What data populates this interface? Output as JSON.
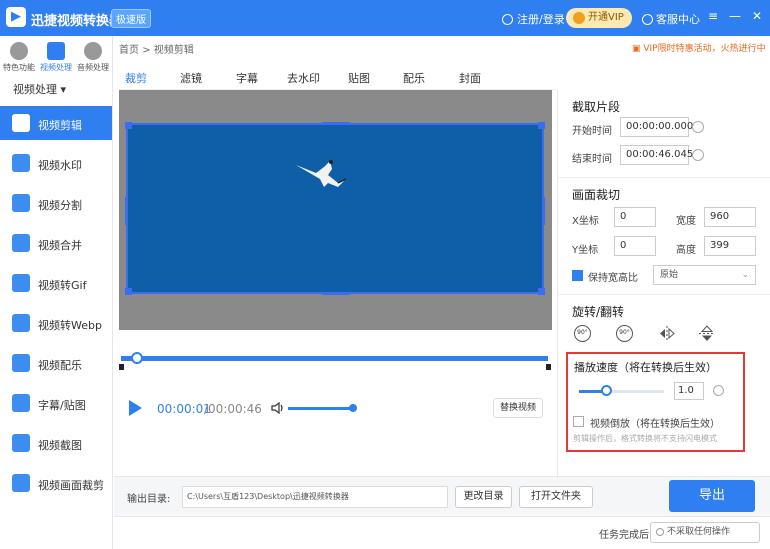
{
  "app": {
    "title": "迅捷视频转换器",
    "edition": "极速版",
    "login": "注册/登录",
    "vip": "开通VIP",
    "service": "客服中心"
  },
  "nav": {
    "top": [
      {
        "label": "特色功能"
      },
      {
        "label": "视频处理"
      },
      {
        "label": "音频处理"
      }
    ],
    "section": "视频处理",
    "items": [
      {
        "label": "视频剪辑"
      },
      {
        "label": "视频水印"
      },
      {
        "label": "视频分割"
      },
      {
        "label": "视频合并"
      },
      {
        "label": "视频转Gif"
      },
      {
        "label": "视频转Webp"
      },
      {
        "label": "视频配乐"
      },
      {
        "label": "字幕/贴图"
      },
      {
        "label": "视频截图"
      },
      {
        "label": "视频画面裁剪"
      }
    ]
  },
  "breadcrumb": {
    "home": "首页",
    "sep": ">",
    "current": "视频剪辑"
  },
  "promo": "VIP限时特惠活动，火热进行中",
  "tabs": [
    "裁剪",
    "滤镜",
    "字幕",
    "去水印",
    "贴图",
    "配乐",
    "封面"
  ],
  "player": {
    "current": "00:00:01",
    "total": "/00:00:46",
    "replace": "替换视频",
    "volume_fraction": 1.0
  },
  "output": {
    "label": "输出目录:",
    "path": "C:\\Users\\互盾123\\Desktop\\迅捷视频转换器",
    "change": "更改目录",
    "open": "打开文件夹",
    "export": "导出"
  },
  "status": {
    "task_label": "任务完成后",
    "task_value": "不采取任何操作"
  },
  "panel": {
    "clip_title": "截取片段",
    "start_label": "开始时间",
    "start_value": "00:00:00.000",
    "end_label": "结束时间",
    "end_value": "00:00:46.045",
    "crop_title": "画面裁切",
    "x_label": "X坐标",
    "x_value": "0",
    "y_label": "Y坐标",
    "y_value": "0",
    "w_label": "宽度",
    "w_value": "960",
    "h_label": "高度",
    "h_value": "399",
    "keep_ratio": "保持宽高比",
    "ratio_value": "原始",
    "rotate_title": "旋转/翻转",
    "rot_left": "90°",
    "rot_right": "90°",
    "speed_title": "播放速度（将在转换后生效）",
    "speed_value": "1.0",
    "reverse_label": "视频倒放（将在转换后生效）",
    "reverse_note": "剪辑操作后，格式转换将不支持闪电模式"
  },
  "colors": {
    "accent": "#2f7ff0",
    "highlight": "#e53935",
    "promo": "#ea6a1c"
  }
}
